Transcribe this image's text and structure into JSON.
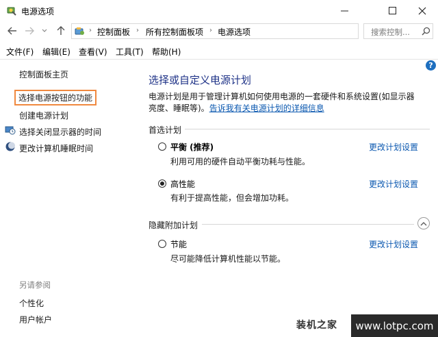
{
  "window": {
    "title": "电源选项"
  },
  "navigation": {
    "breadcrumbs": [
      "控制面板",
      "所有控制面板项",
      "电源选项"
    ],
    "search_placeholder": "搜索控制..."
  },
  "menubar": [
    "文件(F)",
    "编辑(E)",
    "查看(V)",
    "工具(T)",
    "帮助(H)"
  ],
  "sidebar": {
    "links": [
      "控制面板主页",
      "选择电源按钮的功能",
      "创建电源计划",
      "选择关闭显示器的时间",
      "更改计算机睡眠时间"
    ],
    "see_also_heading": "另请参阅",
    "see_also_links": [
      "个性化",
      "用户帐户"
    ]
  },
  "main": {
    "title": "选择或自定义电源计划",
    "description": "电源计划是用于管理计算机如何使用电源的一套硬件和系统设置(如显示器亮度、睡眠等)。",
    "description_link": "告诉我有关电源计划的详细信息",
    "preferred_heading": "首选计划",
    "hidden_heading": "隐藏附加计划",
    "change_label": "更改计划设置",
    "plans": [
      {
        "name": "平衡 (推荐)",
        "desc": "利用可用的硬件自动平衡功耗与性能。",
        "selected": false
      },
      {
        "name": "高性能",
        "desc": "有利于提高性能，但会增加功耗。",
        "selected": true
      },
      {
        "name": "节能",
        "desc": "尽可能降低计算机性能以节能。",
        "selected": false
      }
    ]
  },
  "help_label": "?",
  "watermark": {
    "left": "装机之家",
    "right": "www.lotpc.com"
  },
  "colors": {
    "heading_blue": "#1e3287",
    "link_blue": "#0b58b0",
    "highlight_orange": "#f0883e"
  }
}
